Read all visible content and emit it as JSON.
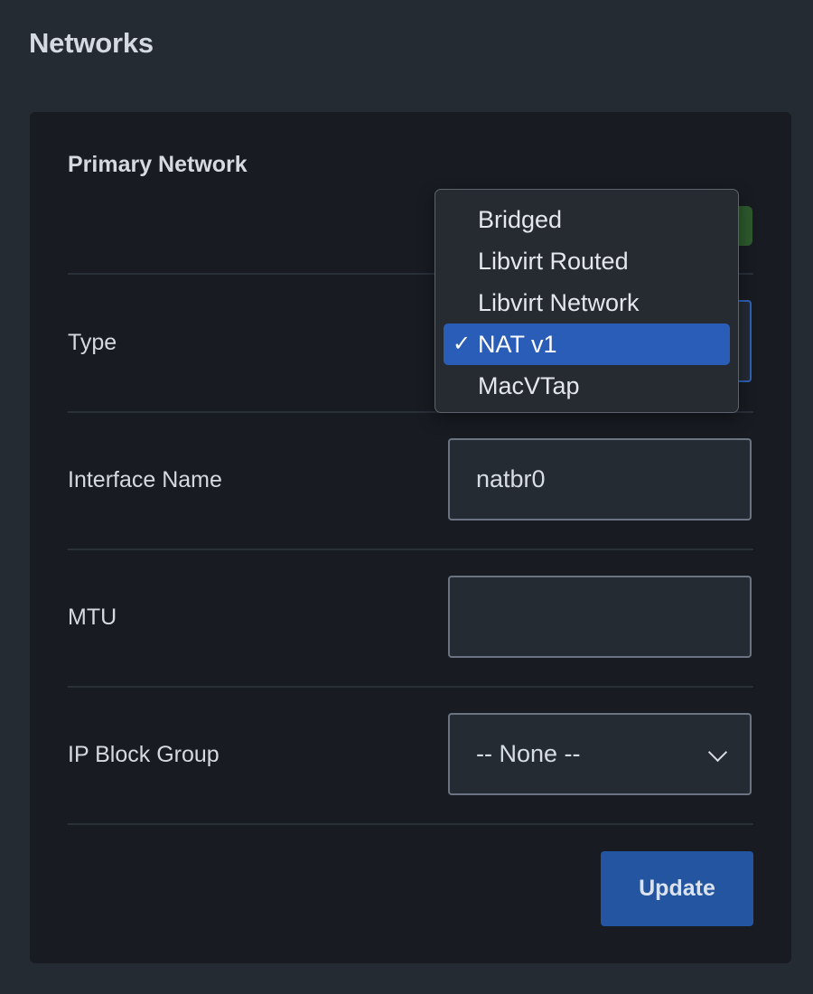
{
  "page": {
    "title": "Networks"
  },
  "card": {
    "title": "Primary Network",
    "rows": {
      "type_label": "Type",
      "interface_label": "Interface Name",
      "interface_value": "natbr0",
      "mtu_label": "MTU",
      "mtu_value": "",
      "ip_block_label": "IP Block Group",
      "ip_block_value": "-- None --"
    },
    "update_label": "Update"
  },
  "type_dropdown": {
    "options": [
      "Bridged",
      "Libvirt Routed",
      "Libvirt Network",
      "NAT v1",
      "MacVTap"
    ],
    "selected_index": 3,
    "checkmark": "✓"
  },
  "colors": {
    "background": "#252b33",
    "card": "#181c22",
    "accent": "#2455a0",
    "selected_option": "#2a5db8",
    "toggle_on": "#2d5a2e"
  }
}
